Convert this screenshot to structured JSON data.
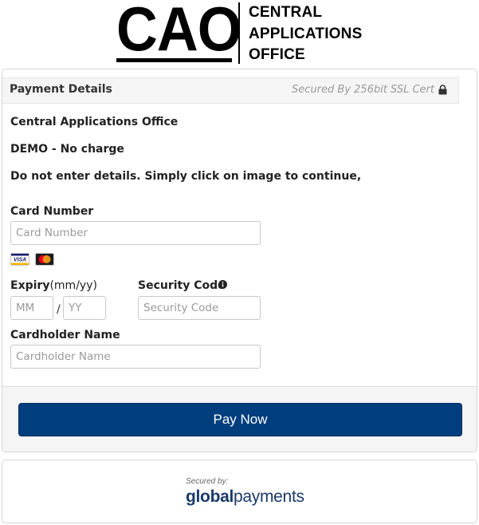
{
  "logo": {
    "abbr": "CAO",
    "line1": "CENTRAL",
    "line2": "APPLICATIONS",
    "line3": "OFFICE"
  },
  "panel": {
    "title": "Payment Details",
    "ssl_text": "Secured By 256bit SSL Cert",
    "org_name": "Central Applications Office",
    "demo_text": "DEMO - No charge",
    "instruction": "Do not enter details. Simply click on image to continue,"
  },
  "form": {
    "card_number_label": "Card Number",
    "card_number_placeholder": "Card Number",
    "card_number_value": "",
    "card_brands": [
      "VISA",
      "MasterCard"
    ],
    "expiry_label": "Expiry",
    "expiry_hint": "(mm/yy)",
    "month_placeholder": "MM",
    "year_placeholder": "YY",
    "separator": "/",
    "security_code_label": "Security Code",
    "security_code_placeholder": "Security Code",
    "cardholder_label": "Cardholder Name",
    "cardholder_placeholder": "Cardholder Name"
  },
  "pay_button": {
    "label": "Pay Now",
    "color": "#003e7e"
  },
  "footer": {
    "secured_by": "Secured by:",
    "brand_part1": "global",
    "brand_part2": "payments",
    "brand_color": "#1a3a6b"
  },
  "icons": {
    "lock": "lock-icon",
    "info": "info-icon",
    "visa": "visa-icon",
    "mastercard": "mastercard-icon"
  }
}
